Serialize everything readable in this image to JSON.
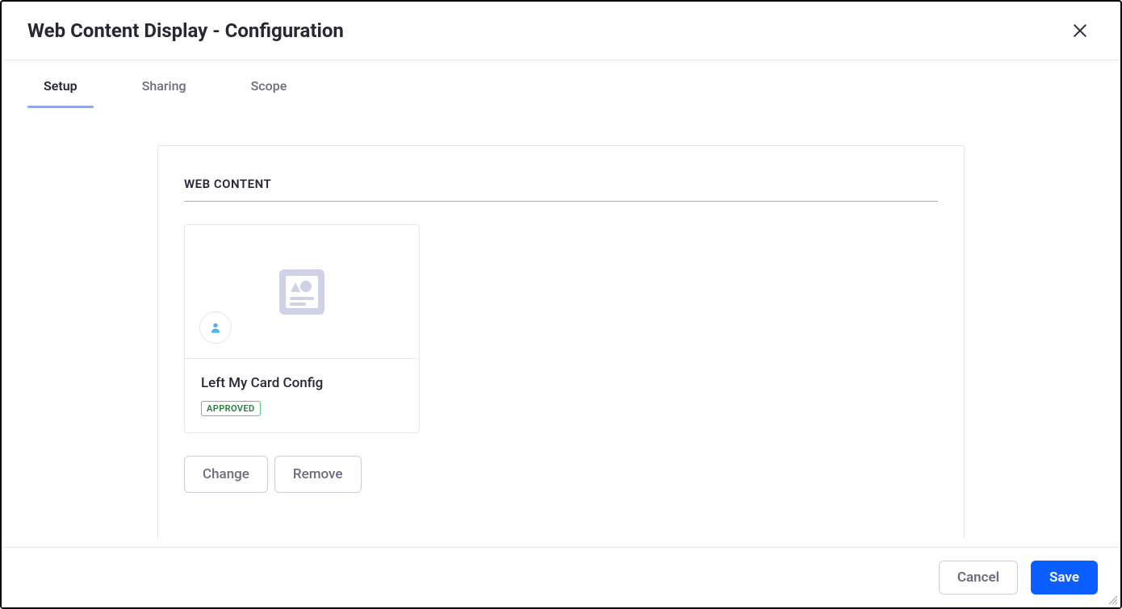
{
  "header": {
    "title": "Web Content Display - Configuration"
  },
  "tabs": [
    {
      "label": "Setup",
      "active": true
    },
    {
      "label": "Sharing",
      "active": false
    },
    {
      "label": "Scope",
      "active": false
    }
  ],
  "panel": {
    "section_title": "WEB CONTENT",
    "card": {
      "title": "Left My Card Config",
      "status": "APPROVED"
    },
    "actions": {
      "change": "Change",
      "remove": "Remove"
    }
  },
  "footer": {
    "cancel": "Cancel",
    "save": "Save"
  }
}
